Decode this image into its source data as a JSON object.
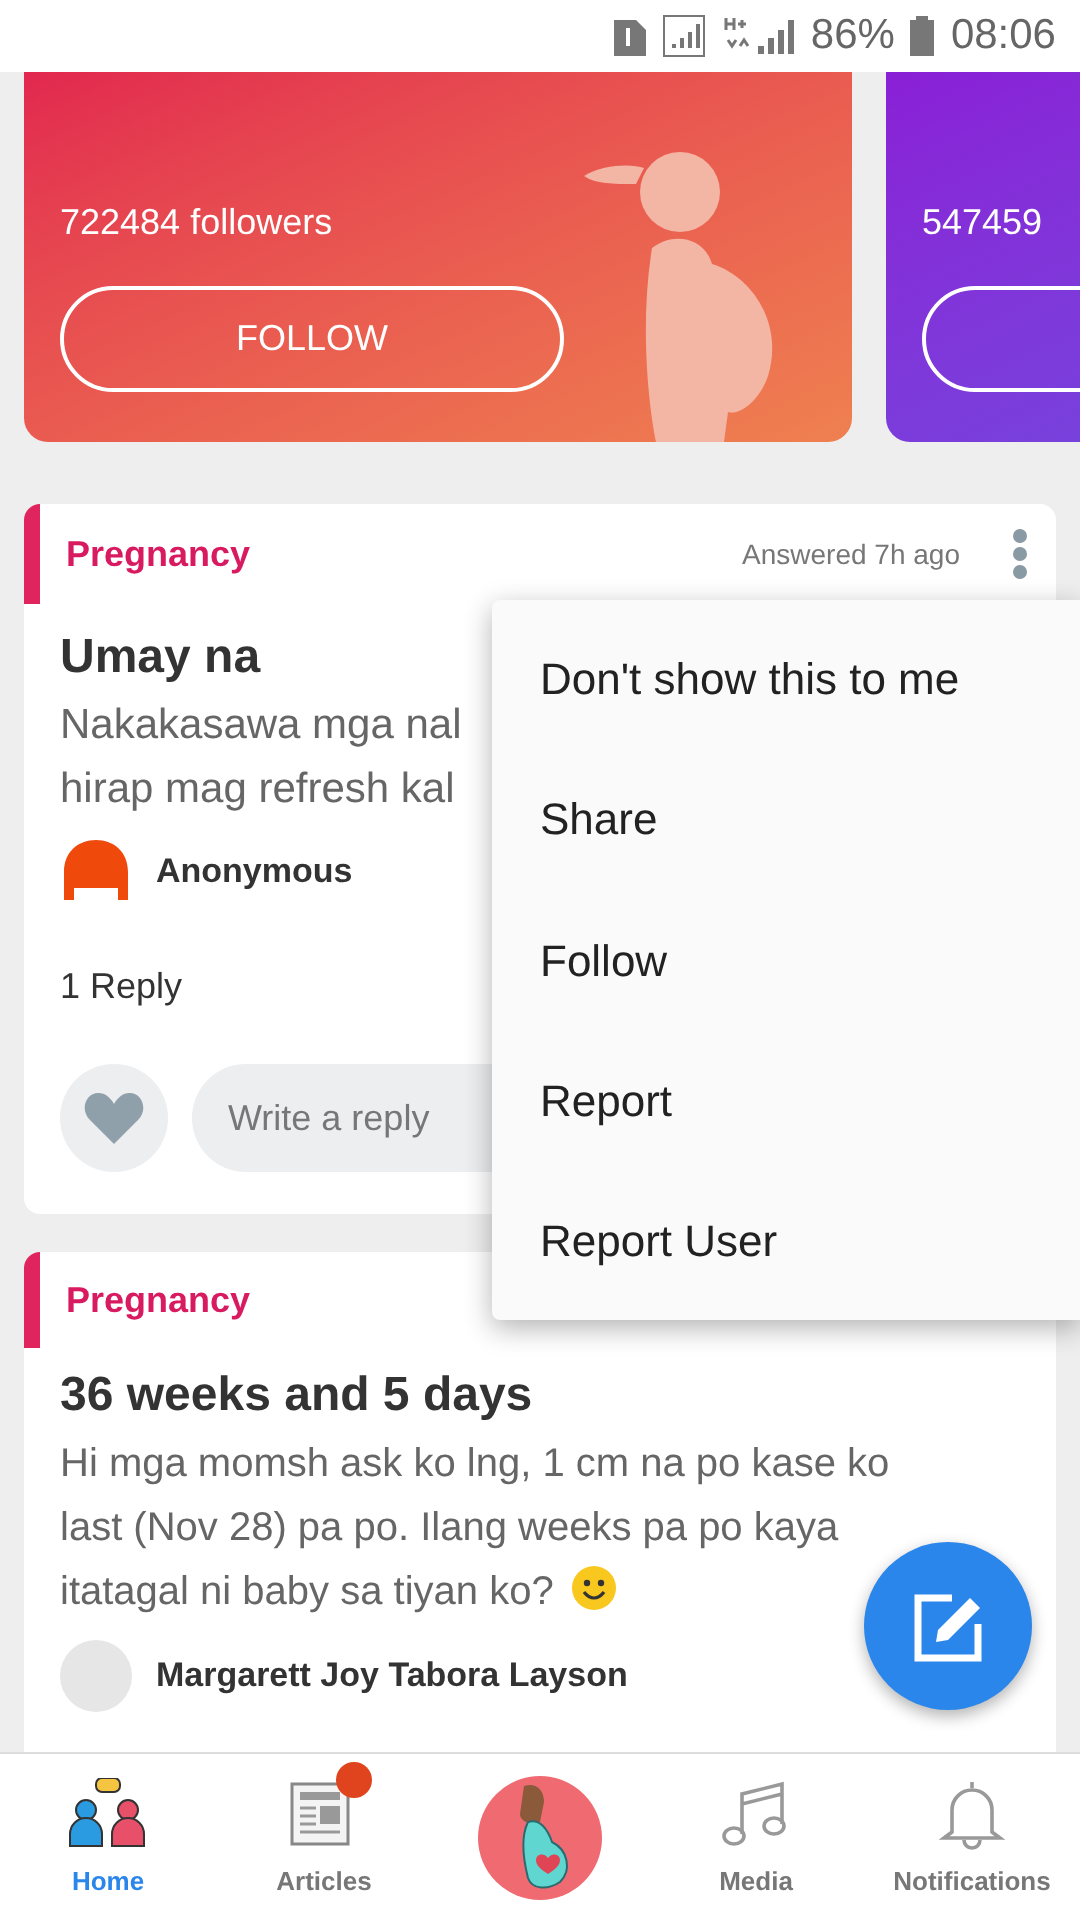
{
  "status_bar": {
    "battery": "86%",
    "time": "08:06"
  },
  "topic_cards": [
    {
      "followers": "722484 followers",
      "button": "FOLLOW",
      "kind": "warm",
      "illustration": true
    },
    {
      "followers": "547459",
      "kind": "cool",
      "illustration": false
    }
  ],
  "posts": [
    {
      "category": "Pregnancy",
      "meta": "Answered 7h ago",
      "title": "Umay na",
      "body": "Nakakasawa mga nal hirap mag refresh kal",
      "author": "Anonymous",
      "avatar_empty": false,
      "replies": "1 Reply",
      "reply_placeholder": "Write a reply"
    },
    {
      "category": "Pregnancy",
      "title": "36 weeks and 5 days",
      "body": "Hi mga momsh ask ko lng, 1 cm na po kase ko last (Nov 28) pa po. Ilang weeks pa po kaya itatagal ni baby sa tiyan ko?",
      "emoji": true,
      "author": "Margarett Joy Tabora Layson",
      "avatar_empty": true
    }
  ],
  "menu": [
    "Don't show this to me",
    "Share",
    "Follow",
    "Report",
    "Report User"
  ],
  "nav": [
    {
      "kind": "home",
      "label": "Home",
      "selected": true,
      "badge": false
    },
    {
      "kind": "articles",
      "label": "Articles",
      "selected": false,
      "badge": true
    },
    {
      "kind": "center",
      "selected": false
    },
    {
      "kind": "media",
      "label": "Media",
      "selected": false,
      "badge": false
    },
    {
      "kind": "notifications",
      "label": "Notifications",
      "selected": false,
      "badge": false
    }
  ]
}
